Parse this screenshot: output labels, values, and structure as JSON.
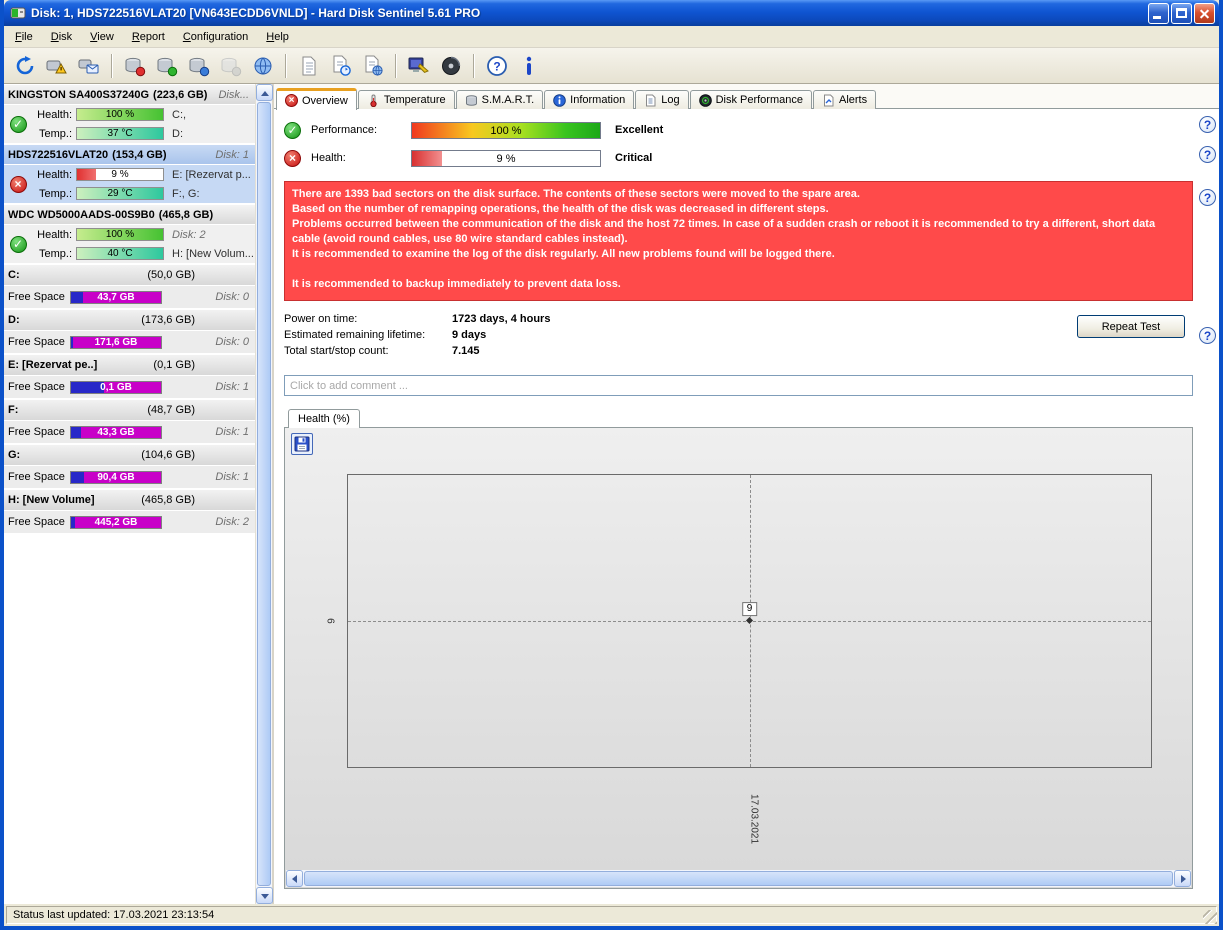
{
  "glyphs": {
    "check": "✓",
    "cross": "×",
    "help": "?",
    "info": "i"
  },
  "window": {
    "title": "Disk: 1, HDS722516VLAT20 [VN643ECDD6VNLD]  -  Hard Disk Sentinel 5.61 PRO"
  },
  "menu": {
    "items": [
      "File",
      "Disk",
      "View",
      "Report",
      "Configuration",
      "Help"
    ]
  },
  "toolbar": {
    "icons": [
      "refresh",
      "disk-warning",
      "disk-monitor",
      "disk-test-red",
      "disk-test-green",
      "disk-test-blue",
      "disk-test-disabled",
      "world",
      "report-document",
      "report-refresh",
      "report-web",
      "surface-test",
      "disk-media",
      "help",
      "information"
    ]
  },
  "sidebar": {
    "disks": [
      {
        "name": "KINGSTON SA400S37240G",
        "size": "(223,6 GB)",
        "disk_no": "Disk...",
        "status": "ok",
        "health_label": "Health:",
        "health_value": "100 %",
        "health_pct": 100,
        "temp_label": "Temp.:",
        "temp_value": "37 °C",
        "temp_pct": 100,
        "right1": "C:,",
        "right2": "D:"
      },
      {
        "name": "HDS722516VLAT20",
        "size": "(153,4 GB)",
        "disk_no": "Disk: 1",
        "status": "error",
        "health_label": "Health:",
        "health_value": "9 %",
        "health_pct": 22,
        "temp_label": "Temp.:",
        "temp_value": "29 °C",
        "temp_pct": 100,
        "right1": "E: [Rezervat p...",
        "right2": "F:, G:"
      },
      {
        "name": "WDC WD5000AADS-00S9B0",
        "size": "(465,8 GB)",
        "disk_no": "",
        "status": "ok",
        "health_label": "Health:",
        "health_value": "100 %",
        "health_pct": 100,
        "temp_label": "Temp.:",
        "temp_value": "40 °C",
        "temp_pct": 100,
        "right1": "Disk: 2",
        "right2": "H: [New Volum..."
      }
    ],
    "partitions": [
      {
        "letter": "C:",
        "size": "(50,0 GB)",
        "free_label": "Free Space",
        "free_value": "43,7 GB",
        "disk_no": "Disk: 0",
        "used_pct": 13
      },
      {
        "letter": "D:",
        "size": "(173,6 GB)",
        "free_label": "Free Space",
        "free_value": "171,6 GB",
        "disk_no": "Disk: 0",
        "used_pct": 2
      },
      {
        "letter": "E: [Rezervat pe..]",
        "size": "(0,1 GB)",
        "free_label": "Free Space",
        "free_value": "0,1 GB",
        "disk_no": "Disk: 1",
        "used_pct": 37
      },
      {
        "letter": "F:",
        "size": "(48,7 GB)",
        "free_label": "Free Space",
        "free_value": "43,3 GB",
        "disk_no": "Disk: 1",
        "used_pct": 11
      },
      {
        "letter": "G:",
        "size": "(104,6 GB)",
        "free_label": "Free Space",
        "free_value": "90,4 GB",
        "disk_no": "Disk: 1",
        "used_pct": 14
      },
      {
        "letter": "H: [New Volume]",
        "size": "(465,8 GB)",
        "free_label": "Free Space",
        "free_value": "445,2 GB",
        "disk_no": "Disk: 2",
        "used_pct": 4
      }
    ]
  },
  "tabs": [
    {
      "label": "Overview",
      "active": true
    },
    {
      "label": "Temperature"
    },
    {
      "label": "S.M.A.R.T."
    },
    {
      "label": "Information"
    },
    {
      "label": "Log"
    },
    {
      "label": "Disk Performance"
    },
    {
      "label": "Alerts"
    }
  ],
  "overview": {
    "performance": {
      "label": "Performance:",
      "value": "100 %",
      "pct": 100,
      "rating": "Excellent"
    },
    "health": {
      "label": "Health:",
      "value": "9 %",
      "pct": 16,
      "rating": "Critical"
    },
    "warning_lines": [
      "There are 1393 bad sectors on the disk surface. The contents of these sectors were moved to the spare area.",
      "Based on the number of remapping operations, the health of the disk was decreased in different steps.",
      "Problems occurred between the communication of the disk and the host 72 times. In case of a sudden crash or reboot it is recommended to try a different, short data cable (avoid round cables, use 80 wire standard cables instead).",
      "It is recommended to examine the log of the disk regularly. All new problems found will be logged there."
    ],
    "warning_final": "It is recommended to backup immediately to prevent data loss.",
    "stats": [
      {
        "label": "Power on time:",
        "value": "1723 days, 4 hours"
      },
      {
        "label": "Estimated remaining lifetime:",
        "value": "9 days"
      },
      {
        "label": "Total start/stop count:",
        "value": "7.145"
      }
    ],
    "repeat_test": "Repeat Test",
    "comment_placeholder": "Click to add comment ..."
  },
  "chart": {
    "tab_label": "Health (%)",
    "point_label": "9",
    "y_tick": "9",
    "x_tick": "17.03.2021",
    "chart_data": {
      "type": "line",
      "title": "Health (%)",
      "x": [
        "17.03.2021"
      ],
      "series": [
        {
          "name": "Health",
          "values": [
            9
          ]
        }
      ],
      "ylim": [
        0,
        100
      ],
      "grid": "crosshair-dashed",
      "legend": false
    }
  },
  "statusbar": {
    "text": "Status last updated: 17.03.2021 23:13:54"
  },
  "colors": {
    "critical_bg": "#FF4A4A",
    "health_red": "#D83030",
    "performance_green": "#30B818",
    "free_magenta": "#C800C8",
    "used_blue": "#2828C8",
    "selected_blue": "#C6D9F4",
    "titlebar_blue": "#0F55D2"
  }
}
